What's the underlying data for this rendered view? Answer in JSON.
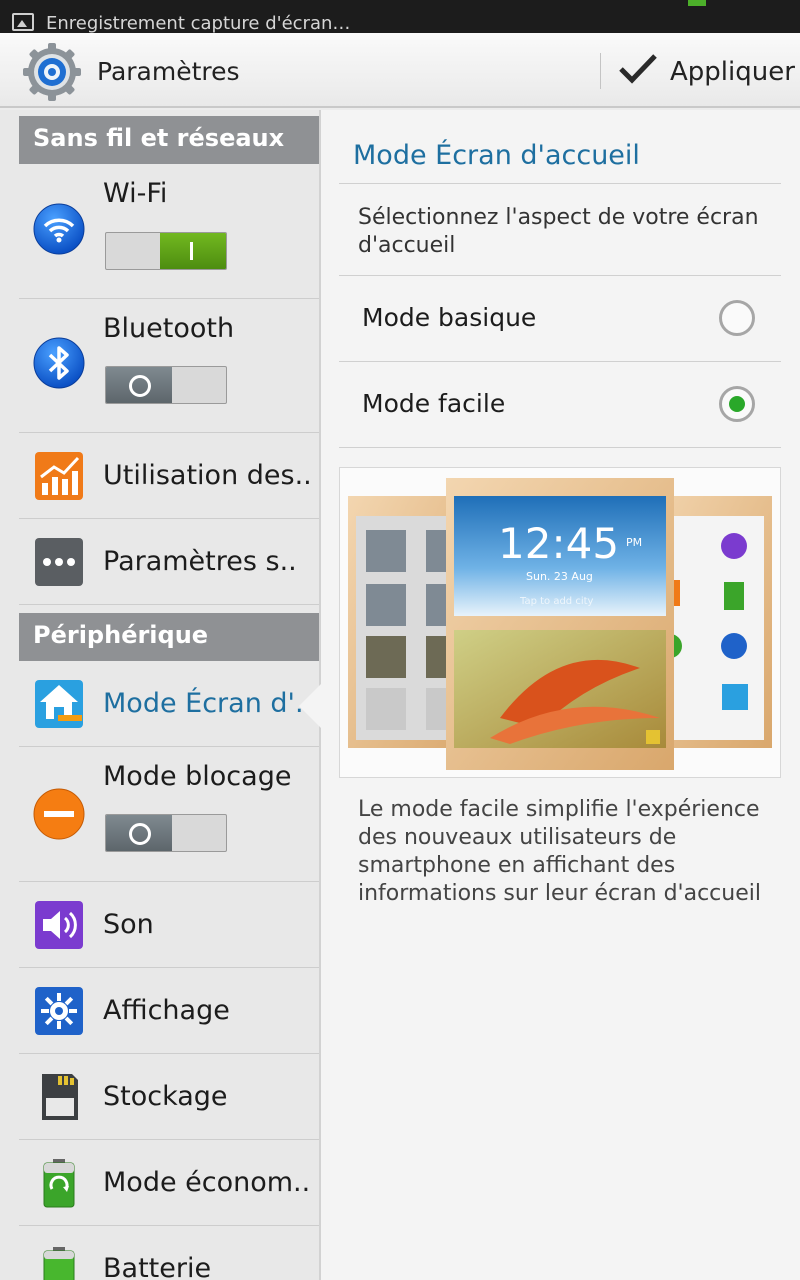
{
  "status_bar": {
    "notification": "Enregistrement capture d'écran…"
  },
  "action_bar": {
    "title": "Paramètres",
    "apply_label": "Appliquer"
  },
  "sidebar": {
    "categories": [
      "Sans fil et réseaux",
      "Périphérique"
    ],
    "items": [
      {
        "label": "Wi-Fi",
        "toggle": "on"
      },
      {
        "label": "Bluetooth",
        "toggle": "off"
      },
      {
        "label": "Utilisation des.."
      },
      {
        "label": "Paramètres s.."
      },
      {
        "label": "Mode Écran d'..",
        "selected": true
      },
      {
        "label": "Mode blocage",
        "toggle": "off"
      },
      {
        "label": "Son"
      },
      {
        "label": "Affichage"
      },
      {
        "label": "Stockage"
      },
      {
        "label": "Mode économ.."
      },
      {
        "label": "Batterie"
      }
    ]
  },
  "detail": {
    "title": "Mode Écran d'accueil",
    "description": "Sélectionnez l'aspect de votre écran d'accueil",
    "options": [
      {
        "label": "Mode basique",
        "selected": false
      },
      {
        "label": "Mode facile",
        "selected": true
      }
    ],
    "preview": {
      "time": "12:45",
      "ampm": "PM",
      "date": "Sun. 23 Aug",
      "hint": "Tap to add city"
    },
    "footer": "Le mode facile simplifie l'expérience des nouveaux utilisateurs de smartphone en affichant des informations sur leur écran d'accueil"
  },
  "colors": {
    "accent": "#1e6fa0",
    "category_bg": "#8f9194",
    "radio_on": "#2aa82a",
    "toggle_on": "#5fa318"
  }
}
